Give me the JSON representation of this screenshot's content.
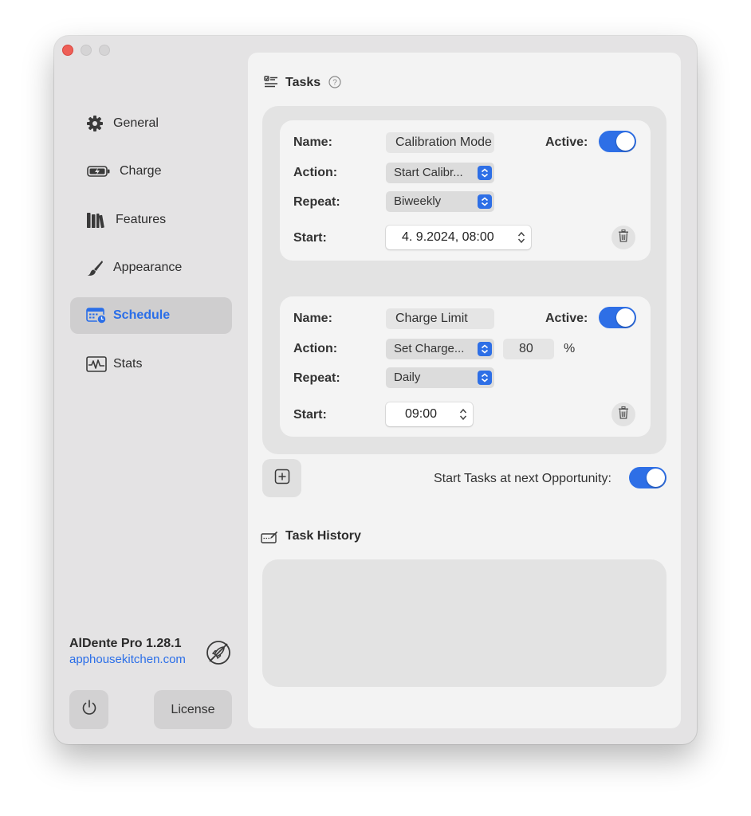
{
  "sidebar": {
    "items": [
      {
        "label": "General",
        "icon": "gear-icon"
      },
      {
        "label": "Charge",
        "icon": "battery-charging-icon"
      },
      {
        "label": "Features",
        "icon": "books-icon"
      },
      {
        "label": "Appearance",
        "icon": "paintbrush-icon"
      },
      {
        "label": "Schedule",
        "icon": "calendar-clock-icon",
        "active": true
      },
      {
        "label": "Stats",
        "icon": "waveform-chart-icon"
      }
    ],
    "app_name": "AlDente Pro 1.28.1",
    "app_url": "apphousekitchen.com",
    "license_label": "License"
  },
  "tasks": {
    "title": "Tasks",
    "items": [
      {
        "name_label": "Name:",
        "name_value": "Calibration Mode",
        "active_label": "Active:",
        "active": true,
        "action_label": "Action:",
        "action_value": "Start Calibr...",
        "repeat_label": "Repeat:",
        "repeat_value": "Biweekly",
        "start_label": "Start:",
        "start_value": "4.  9.2024, 08:00"
      },
      {
        "name_label": "Name:",
        "name_value": "Charge Limit",
        "active_label": "Active:",
        "active": true,
        "action_label": "Action:",
        "action_value": "Set Charge...",
        "action_amount": "80",
        "action_unit": "%",
        "repeat_label": "Repeat:",
        "repeat_value": "Daily",
        "start_label": "Start:",
        "start_value": "09:00"
      }
    ],
    "next_opportunity_label": "Start Tasks at next Opportunity:",
    "next_opportunity_enabled": true
  },
  "history": {
    "title": "Task History"
  },
  "colors": {
    "accent": "#2e6fe6",
    "link": "#2a6ee8",
    "close": "#ee5f57"
  }
}
